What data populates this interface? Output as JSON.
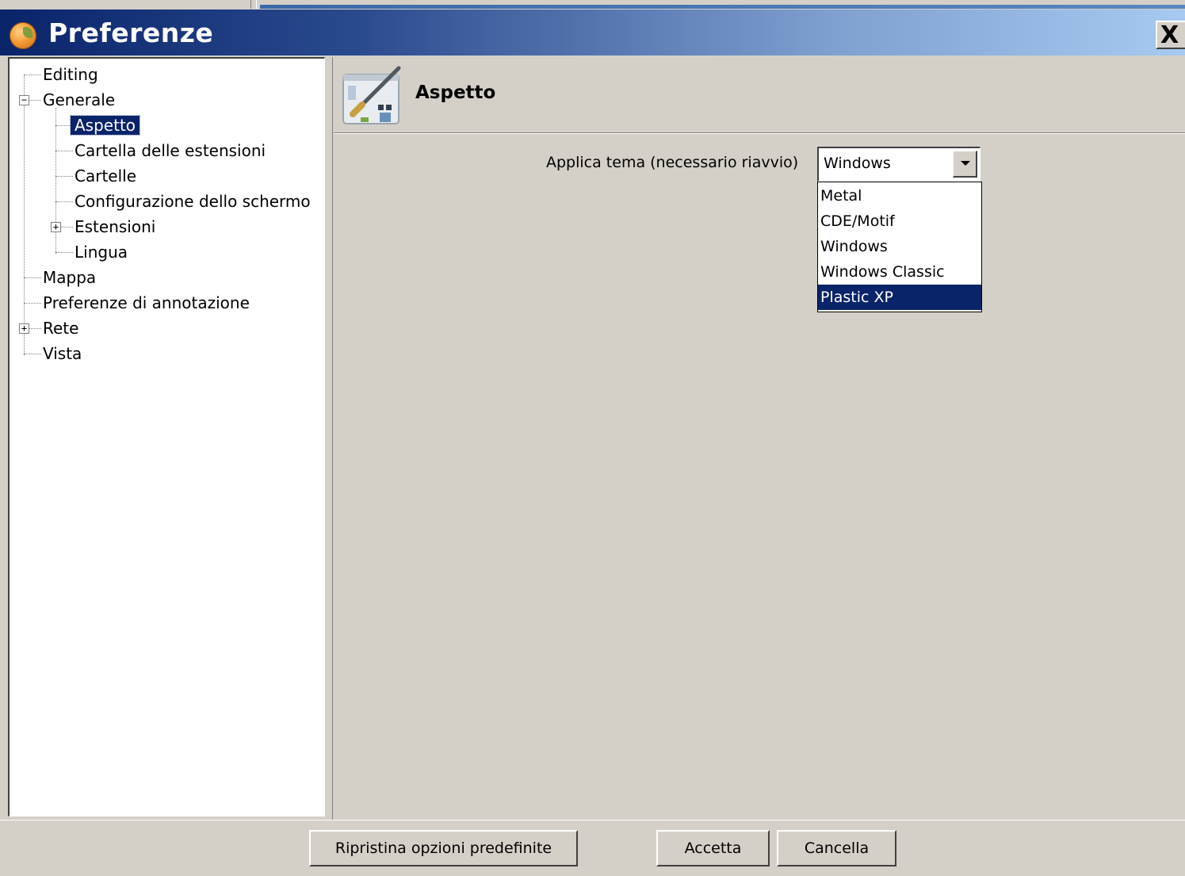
{
  "window": {
    "title": "Preferenze",
    "close_label": "X"
  },
  "tree": {
    "items": [
      {
        "label": "Editing"
      },
      {
        "label": "Generale",
        "expanded": true
      },
      {
        "label": "Aspetto",
        "selected": true
      },
      {
        "label": "Cartella delle estensioni"
      },
      {
        "label": "Cartelle"
      },
      {
        "label": "Configurazione dello schermo"
      },
      {
        "label": "Estensioni",
        "expanded": false
      },
      {
        "label": "Lingua"
      },
      {
        "label": "Mappa"
      },
      {
        "label": "Preferenze di annotazione"
      },
      {
        "label": "Rete",
        "expanded": false
      },
      {
        "label": "Vista"
      }
    ]
  },
  "panel": {
    "title": "Aspetto",
    "header_icon": "paintbrush-appearance-icon"
  },
  "theme": {
    "label": "Applica tema (necessario riavvio)",
    "selected": "Windows",
    "options": [
      "Metal",
      "CDE/Motif",
      "Windows",
      "Windows Classic",
      "Plastic XP"
    ],
    "highlighted": "Plastic XP"
  },
  "footer": {
    "reset_label": "Ripristina opzioni predefinite",
    "accept_label": "Accetta",
    "cancel_label": "Cancella"
  },
  "colors": {
    "selection": "#0a246a",
    "window_bg": "#d4d0c8"
  }
}
